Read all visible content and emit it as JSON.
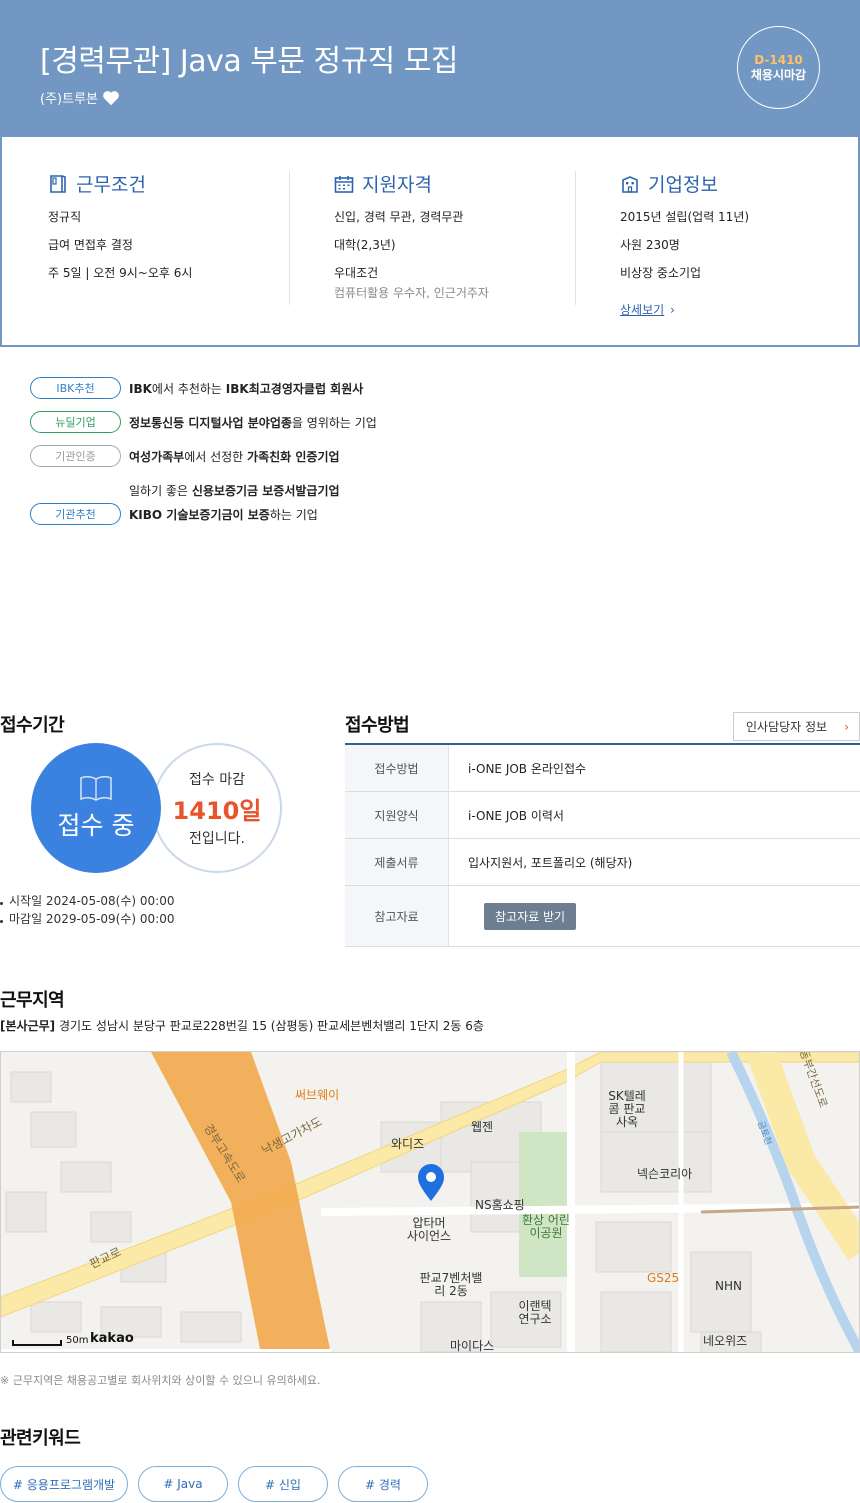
{
  "header": {
    "title": "[경력무관] Java 부문 정규직 모집",
    "company": "(주)트루본",
    "dday_code": "D-1410",
    "dday_label": "채용시마감"
  },
  "info": {
    "work": {
      "title": "근무조건",
      "lines": [
        "정규직",
        "급여 면접후 결정",
        "주 5일 | 오전 9시~오후 6시"
      ]
    },
    "qualification": {
      "title": "지원자격",
      "lines": [
        "신입, 경력 무관, 경력무관",
        "대학(2,3년)",
        "우대조건"
      ],
      "sub": "컴퓨터활용 우수자, 인근거주자"
    },
    "company": {
      "title": "기업정보",
      "lines": [
        "2015년 설립(업력 11년)",
        "사원 230명",
        "비상장 중소기업"
      ],
      "more": "상세보기"
    }
  },
  "badges": [
    {
      "label": "IBK추천",
      "color": "#2f7fc7",
      "pre": "",
      "b1": "IBK",
      "mid": "에서 추천하는 ",
      "b2": "IBK최고경영자클럽 회원사",
      "post": ""
    },
    {
      "label": "뉴딜기업",
      "color": "#2e9f5c",
      "pre": "",
      "b1": "정보통신등 디지털사업 분야업종",
      "mid": "을 영위하는 기업",
      "b2": "",
      "post": ""
    },
    {
      "label": "기관인증",
      "color": "#999999",
      "pre": "",
      "b1": "여성가족부",
      "mid": "에서 선정한 ",
      "b2": "가족친화 인증기업",
      "post": ""
    },
    {
      "label": "기관추천",
      "color": "#2f7fc7",
      "pre": "일하기 좋은 ",
      "b1": "신용보증기금 보증서발급기업",
      "mid": "",
      "b2": "",
      "post": "",
      "pre2": "",
      "b3": "KIBO 기술보증기금이 보증",
      "post2": "하는 기업"
    }
  ],
  "period": {
    "title": "접수기간",
    "status": "접수 중",
    "deadline_label": "접수 마감",
    "days": "1410일",
    "suffix": "전입니다.",
    "start": "시작일 2024-05-08(수) 00:00",
    "end": "마감일 2029-05-09(수) 00:00"
  },
  "method": {
    "title": "접수방법",
    "hr_button": "인사담당자 정보",
    "rows": [
      {
        "key": "접수방법",
        "value": "i-ONE JOB 온라인접수"
      },
      {
        "key": "지원양식",
        "value": "i-ONE JOB 이력서"
      },
      {
        "key": "제출서류",
        "value": "입사지원서, 포트폴리오 (해당자)"
      },
      {
        "key": "참고자료",
        "button": "참고자료 받기"
      }
    ]
  },
  "location": {
    "title": "근무지역",
    "tag": "[본사근무]",
    "address": " 경기도 성남시 분당구 판교로228번길 15 (삼평동) 판교세븐벤처밸리 1단지 2동 6층",
    "note": "※ 근무지역은 채용공고별로 회사위치와 상이할 수 있으니 유의하세요.",
    "map": {
      "labels": [
        "써브웨이",
        "웹젠",
        "와디즈",
        "SK텔레콤 판교사옥",
        "넥슨코리아",
        "NS홈쇼핑",
        "환상 어린이공원",
        "압타머 사이언스",
        "판교7벤처밸리 2동",
        "GS25",
        "NHN",
        "이랜텍 연구소",
        "마이다스",
        "네오위즈",
        "경부고속도로",
        "낙생고가차도",
        "판교로",
        "금토천",
        "동부간선도로"
      ],
      "scale": "50m",
      "brand": "kakao"
    }
  },
  "keywords": {
    "title": "관련키워드",
    "items": [
      "# 응용프로그램개발",
      "# Java",
      "# 신입",
      "# 경력"
    ]
  }
}
